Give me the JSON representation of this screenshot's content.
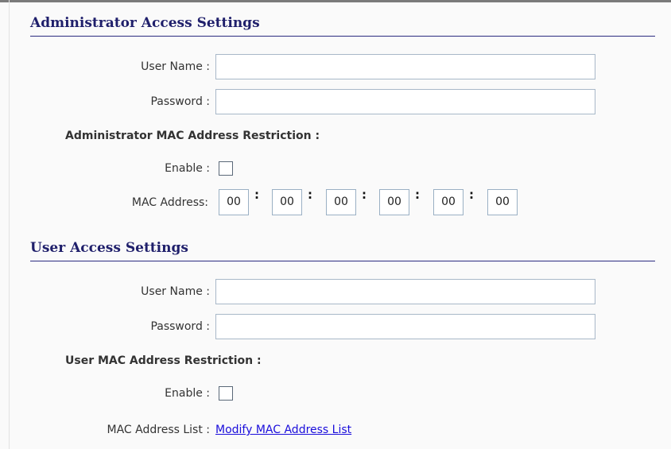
{
  "admin": {
    "title": "Administrator Access Settings",
    "user_name_label": "User Name :",
    "user_name_value": "",
    "password_label": "Password :",
    "password_value": "",
    "mac_restriction_label": "Administrator MAC Address Restriction :",
    "enable_label": "Enable :",
    "enable_checked": false,
    "mac_address_label": "MAC Address:",
    "mac_octets": [
      "00",
      "00",
      "00",
      "00",
      "00",
      "00"
    ],
    "mac_separator": ":"
  },
  "user": {
    "title": "User Access Settings",
    "user_name_label": "User Name :",
    "user_name_value": "",
    "password_label": "Password :",
    "password_value": "",
    "mac_restriction_label": "User MAC Address Restriction :",
    "enable_label": "Enable :",
    "enable_checked": false,
    "mac_list_label": "MAC Address List :",
    "mac_list_link": "Modify MAC Address List"
  }
}
